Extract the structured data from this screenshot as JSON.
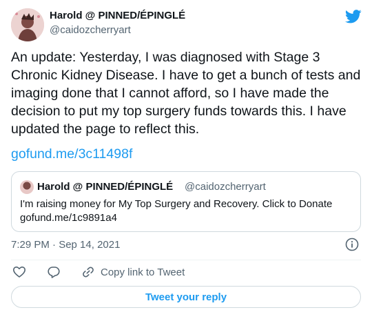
{
  "author": {
    "name": "Harold @ PINNED/ÉPINGLÉ",
    "handle": "@caidozcherryart"
  },
  "tweet": {
    "text": "An update: Yesterday, I was diagnosed with Stage 3 Chronic Kidney Disease. I have to get a bunch of tests and imaging done that I cannot afford, so I have made the decision to put my top surgery funds towards this. I have updated the page to reflect this.",
    "link": "gofund.me/3c11498f",
    "timestamp": "7:29 PM · Sep 14, 2021"
  },
  "quoted": {
    "name": "Harold @ PINNED/ÉPINGLÉ",
    "handle": "@caidozcherryart",
    "text": "I'm raising money for My Top Surgery and Recovery. Click to Donate gofund.me/1c9891a4"
  },
  "actions": {
    "copy_label": "Copy link to Tweet",
    "reply_button": "Tweet your reply"
  },
  "colors": {
    "accent": "#1d9bf0",
    "secondary_text": "#536471",
    "border": "#cfd9de"
  },
  "icons": {
    "brand": "twitter-bird-icon",
    "info": "info-icon",
    "like": "heart-icon",
    "reply": "reply-icon",
    "copy": "link-icon"
  }
}
